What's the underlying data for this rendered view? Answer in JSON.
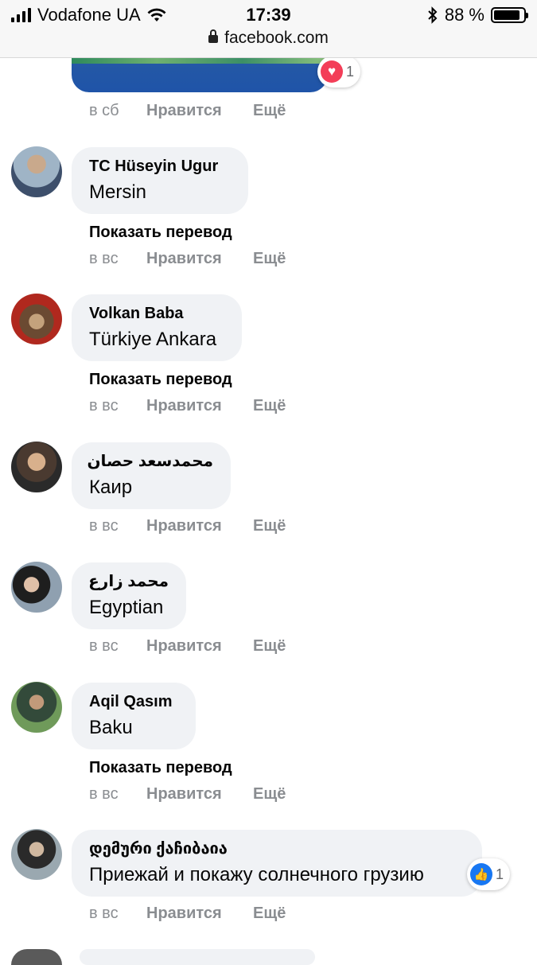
{
  "status_bar": {
    "carrier": "Vodafone UA",
    "time": "17:39",
    "battery": "88 %",
    "battery_level": 0.88,
    "url": "facebook.com",
    "icons": [
      "signal-icon",
      "wifi-icon",
      "bluetooth-icon",
      "battery-icon",
      "lock-icon"
    ]
  },
  "top_post": {
    "reaction_icon": "heart-icon",
    "reaction_count": "1",
    "actions": {
      "time": "в сб",
      "like": "Нравится",
      "more": "Ещё"
    }
  },
  "translate_label": "Показать перевод",
  "comments": [
    {
      "name": "TC Hüseyin Ugur",
      "text": "Mersin",
      "show_translate": true,
      "actions": {
        "time": "в вс",
        "like": "Нравится",
        "more": "Ещё"
      }
    },
    {
      "name": "Volkan Baba",
      "text": "Türkiye Ankara",
      "show_translate": true,
      "actions": {
        "time": "в вс",
        "like": "Нравится",
        "more": "Ещё"
      }
    },
    {
      "name": "محمدسعد حصان",
      "text": "Каир",
      "show_translate": false,
      "actions": {
        "time": "в вс",
        "like": "Нравится",
        "more": "Ещё"
      }
    },
    {
      "name": "محمد زارع",
      "text": "Egyptian",
      "show_translate": false,
      "actions": {
        "time": "в вс",
        "like": "Нравится",
        "more": "Ещё"
      }
    },
    {
      "name": "Aqil Qasım",
      "text": "Baku",
      "show_translate": true,
      "actions": {
        "time": "в вс",
        "like": "Нравится",
        "more": "Ещё"
      }
    },
    {
      "name": "დემური ქაჩიბაია",
      "text": "Приежай и покажу солнечного грузию",
      "show_translate": false,
      "reaction_icon": "like-icon",
      "reaction_count": "1",
      "actions": {
        "time": "в вс",
        "like": "Нравится",
        "more": "Ещё"
      }
    }
  ]
}
